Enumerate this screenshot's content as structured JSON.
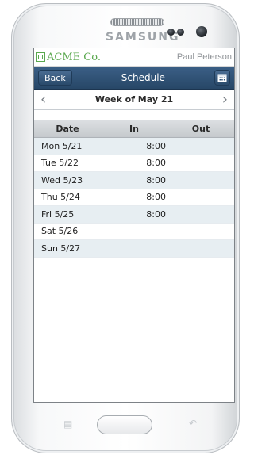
{
  "device": {
    "brand": "SAMSUNG"
  },
  "app": {
    "logo_text": "ACME Co.",
    "user_name": "Paul Peterson"
  },
  "navbar": {
    "back_label": "Back",
    "title": "Schedule",
    "calendar_icon": "calendar-icon"
  },
  "week": {
    "label": "Week of May 21",
    "prev_icon": "chevron-left-icon",
    "next_icon": "chevron-right-icon"
  },
  "table": {
    "headers": [
      "Date",
      "In",
      "Out"
    ],
    "rows": [
      {
        "date": "Mon 5/21",
        "in": "8:00",
        "out": ""
      },
      {
        "date": "Tue 5/22",
        "in": "8:00",
        "out": ""
      },
      {
        "date": "Wed 5/23",
        "in": "8:00",
        "out": ""
      },
      {
        "date": "Thu 5/24",
        "in": "8:00",
        "out": ""
      },
      {
        "date": "Fri 5/25",
        "in": "8:00",
        "out": ""
      },
      {
        "date": "Sat 5/26",
        "in": "",
        "out": ""
      },
      {
        "date": "Sun 5/27",
        "in": "",
        "out": ""
      }
    ]
  },
  "colors": {
    "navbar": "#2f5378",
    "logo_green": "#5aa84e",
    "row_alt": "#e7eef2"
  }
}
